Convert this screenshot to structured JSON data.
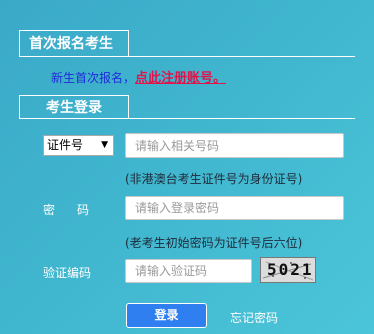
{
  "first_register": {
    "title": "首次报名考生",
    "prompt_text": "新生首次报名，",
    "link_text": "点此注册账号。"
  },
  "login": {
    "title": "考生登录",
    "id_type_select": {
      "selected": "证件号",
      "arrow": "▼"
    },
    "id_input": {
      "placeholder": "请输入相关号码"
    },
    "id_hint": "(非港澳台考生证件号为身份证号)",
    "password_label": "密码",
    "password_input": {
      "placeholder": "请输入登录密码"
    },
    "password_hint": "(老考生初始密码为证件号后六位)",
    "captcha_label": "验证编码",
    "captcha_input": {
      "placeholder": "请输入验证码"
    },
    "captcha_image_text": "5021",
    "login_button": "登录",
    "forgot_password": "忘记密码"
  },
  "colors": {
    "background": "#41b7cf",
    "register_link": "#e0144b",
    "prompt_text": "#1f2bd9",
    "login_button": "#2f7ff0"
  }
}
